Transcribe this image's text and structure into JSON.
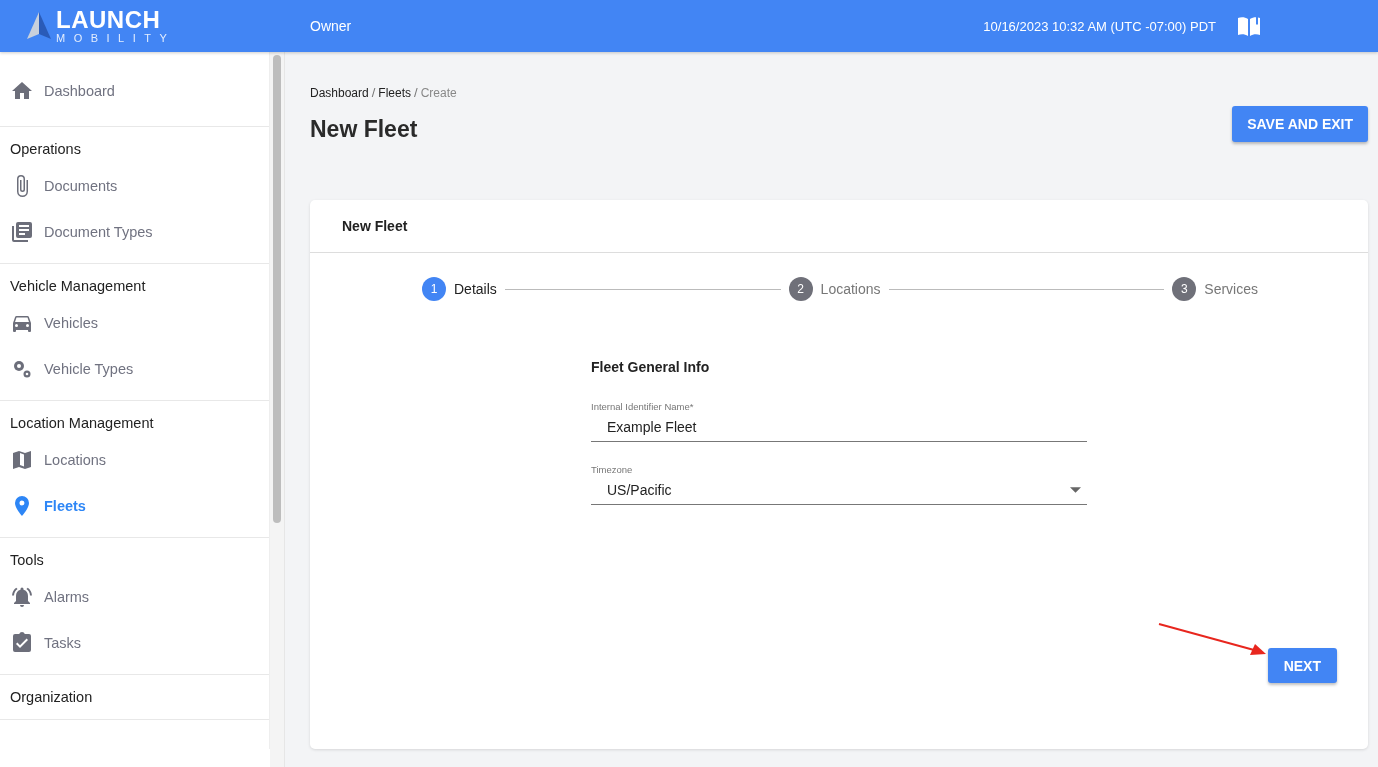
{
  "header": {
    "logo_title": "LAUNCH",
    "logo_subtitle": "MOBILITY",
    "role": "Owner",
    "datetime": "10/16/2023 10:32 AM (UTC -07:00) PDT"
  },
  "sidebar": {
    "top_items": [
      {
        "label": "Dashboard",
        "kind": "home",
        "selected": false
      }
    ],
    "sections": [
      {
        "title": "Operations",
        "items": [
          {
            "label": "Documents",
            "kind": "paperclip",
            "selected": false
          },
          {
            "label": "Document Types",
            "kind": "doclist",
            "selected": false
          }
        ]
      },
      {
        "title": "Vehicle Management",
        "items": [
          {
            "label": "Vehicles",
            "kind": "car",
            "selected": false
          },
          {
            "label": "Vehicle Types",
            "kind": "gears",
            "selected": false
          }
        ]
      },
      {
        "title": "Location Management",
        "items": [
          {
            "label": "Locations",
            "kind": "map",
            "selected": false
          },
          {
            "label": "Fleets",
            "kind": "pin",
            "selected": true
          }
        ]
      },
      {
        "title": "Tools",
        "items": [
          {
            "label": "Alarms",
            "kind": "bell",
            "selected": false
          },
          {
            "label": "Tasks",
            "kind": "task",
            "selected": false
          }
        ]
      },
      {
        "title": "Organization"
      }
    ]
  },
  "breadcrumb": [
    {
      "label": "Dashboard",
      "kind": "link"
    },
    {
      "separator": "/",
      "kind": "separator"
    },
    {
      "label": "Fleets",
      "kind": "link"
    },
    {
      "separator": "/",
      "kind": "separator"
    },
    {
      "label": "Create",
      "kind": "current"
    }
  ],
  "page_title": "New Fleet",
  "save_button": "SAVE AND EXIT",
  "card": {
    "title": "New Fleet",
    "steps": [
      {
        "number": "1",
        "label": "Details",
        "selected": true
      },
      {
        "number": "2",
        "label": "Locations",
        "selected": false
      },
      {
        "number": "3",
        "label": "Services",
        "selected": false
      }
    ],
    "form_title": "Fleet General Info",
    "fields": [
      {
        "kind": "text",
        "label": "Internal Identifier Name*",
        "value": "Example Fleet"
      },
      {
        "kind": "select",
        "label": "Timezone",
        "value": "US/Pacific"
      }
    ],
    "next_button": "NEXT"
  }
}
